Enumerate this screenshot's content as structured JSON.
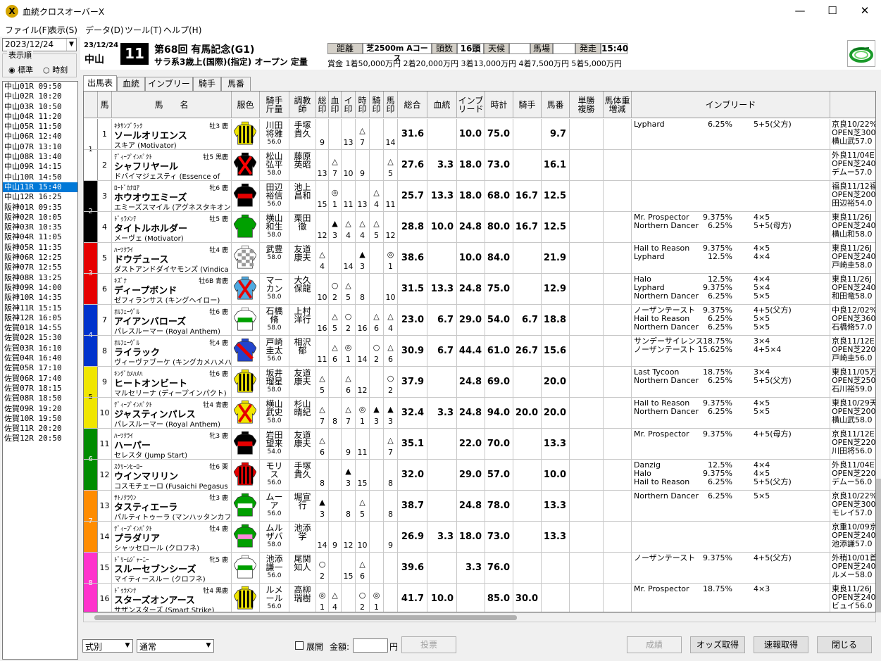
{
  "window": {
    "title": "血統クロスオーバーX",
    "icon_letter": "X",
    "minimize": "—",
    "maximize": "☐",
    "close": "✕"
  },
  "menu": [
    "ファイル(F)",
    "表示(S)",
    "データ(D)",
    "ツール(T)",
    "ヘルプ(H)"
  ],
  "left": {
    "date": "2023/12/24",
    "order_label": "表示順",
    "radio_standard": "標準",
    "radio_time": "時刻",
    "selected_index": 10,
    "races": [
      "中山01R 09:50",
      "中山02R 10:20",
      "中山03R 10:50",
      "中山04R 11:20",
      "中山05R 11:50",
      "中山06R 12:40",
      "中山07R 13:10",
      "中山08R 13:40",
      "中山09R 14:15",
      "中山10R 14:50",
      "中山11R 15:40",
      "中山12R 16:25",
      "阪神01R 09:35",
      "阪神02R 10:05",
      "阪神03R 10:35",
      "阪神04R 11:05",
      "阪神05R 11:35",
      "阪神06R 12:25",
      "阪神07R 12:55",
      "阪神08R 13:25",
      "阪神09R 14:00",
      "阪神10R 14:35",
      "阪神11R 15:15",
      "阪神12R 16:05",
      "佐賀01R 14:55",
      "佐賀02R 15:30",
      "佐賀03R 16:10",
      "佐賀04R 16:40",
      "佐賀05R 17:10",
      "佐賀06R 17:40",
      "佐賀07R 18:15",
      "佐賀08R 18:50",
      "佐賀09R 19:20",
      "佐賀10R 19:50",
      "佐賀11R 20:20",
      "佐賀12R 20:50"
    ]
  },
  "header": {
    "date": "23/12/24",
    "venue": "中山",
    "race_number": "11",
    "race_name": "第68回 有馬記念(G1)",
    "conditions": "サラ系3歳上(国際)(指定) オープン 定量",
    "distance_label": "距離",
    "distance": "芝2500m Aコース",
    "runners_label": "頭数",
    "runners": "16頭",
    "weather_label": "天候",
    "weather": "",
    "track_label": "馬場",
    "track": "",
    "start_label": "発走",
    "start": "15:40",
    "prize": "賞金 1着50,000万円  2着20,000万円  3着13,000万円  4着7,500万円  5着5,000万円"
  },
  "tabs": [
    "出馬表",
    "血統",
    "インブリード",
    "騎手",
    "馬番"
  ],
  "columns": {
    "umaban": "馬",
    "name": "馬　　名",
    "silk": "服色",
    "jockey": "騎手\n斤量",
    "trainer": "調教\n師",
    "m1": "総\n印",
    "m2": "血\n印",
    "m3": "イ\n印",
    "m4": "時\n印",
    "m5": "騎\n印",
    "m6": "馬\n印",
    "total": "総合",
    "blood": "血統",
    "inbreed": "インブ\nリード",
    "time": "時計",
    "jk": "騎手",
    "uma": "馬番",
    "odds": "単勝\n複勝",
    "weight": "馬体重\n増減",
    "inb_detail": "インブリード"
  },
  "waku_colors": [
    "#ffffff",
    "#000000",
    "#e60000",
    "#0033cc",
    "#f0e600",
    "#008c00",
    "#ff8c00",
    "#ff33cc"
  ],
  "horses": [
    {
      "waku": 1,
      "no": "1",
      "sire": "ｷﾀｻﾝﾌﾞﾗｯｸ",
      "meta": "牡3 鹿",
      "name": "ソールオリエンス",
      "dam": "スキア (Motivator)",
      "jockey": "川田\n将雅",
      "wt": "56.0",
      "trainer": "手塚\n貴久",
      "marks": [
        "9",
        "",
        "13",
        "△7",
        "",
        "14"
      ],
      "total": "31.6",
      "blood": "",
      "inbreed": "10.0",
      "time": "75.0",
      "jk": "",
      "uma": "9.7",
      "inb": [
        [
          "Lyphard",
          "6.25%",
          "5+5(父方)"
        ]
      ],
      "prev": [
        "京良10/22%",
        "OPEN芝300",
        "横山武57.0"
      ],
      "silk": [
        "#f0e600",
        "#000000",
        "stripe"
      ]
    },
    {
      "waku": 1,
      "no": "2",
      "sire": "ﾃﾞｨｰﾌﾟｲﾝﾊﾟｸﾄ",
      "meta": "牡5 黒鹿",
      "name": "シャフリヤール",
      "dam": "ドバイマジェスティ (Essence of",
      "jockey": "松山\n弘平",
      "wt": "58.0",
      "trainer": "藤原\n英昭",
      "marks": [
        "13",
        "△7",
        "10",
        "9",
        "",
        "△5"
      ],
      "total": "27.6",
      "blood": "3.3",
      "inbreed": "18.0",
      "time": "73.0",
      "jk": "",
      "uma": "16.1",
      "inb": [],
      "prev": [
        "外良11/04E",
        "OPEN芝240",
        "デムー57.0"
      ],
      "silk": [
        "#000000",
        "#ff0000",
        "cross"
      ]
    },
    {
      "waku": 2,
      "no": "3",
      "sire": "ﾛｰﾄﾞｶﾅﾛｱ",
      "meta": "牝6 鹿",
      "name": "ホウオウエミーズ",
      "dam": "エミーズスマイル (アグネスタキオン)",
      "jockey": "田辺\n裕信",
      "wt": "56.0",
      "trainer": "池上\n昌和",
      "marks": [
        "15",
        "◎1",
        "11",
        "13",
        "△4",
        "11"
      ],
      "total": "25.7",
      "blood": "13.3",
      "inbreed": "18.0",
      "time": "68.0",
      "jk": "16.7",
      "uma": "12.5",
      "inb": [],
      "prev": [
        "福良11/12福",
        "OPEN芝200",
        "田辺裕54.0"
      ],
      "silk": [
        "#000000",
        "#e60000",
        "band"
      ]
    },
    {
      "waku": 2,
      "no": "4",
      "sire": "ﾄﾞｩﾗﾒﾝﾃ",
      "meta": "牡5 鹿",
      "name": "タイトルホルダー",
      "dam": "メーヴェ (Motivator)",
      "jockey": "横山\n和生",
      "wt": "58.0",
      "trainer": "栗田\n徹",
      "marks": [
        "12",
        "▲3",
        "△4",
        "△4",
        "△5",
        "12"
      ],
      "total": "28.8",
      "blood": "10.0",
      "inbreed": "24.8",
      "time": "80.0",
      "jk": "16.7",
      "uma": "12.5",
      "inb": [
        [
          "Mr. Prospector",
          "9.375%",
          "4×5"
        ],
        [
          "Northern Dancer",
          "6.25%",
          "5+5(母方)"
        ]
      ],
      "prev": [
        "東良11/26J",
        "OPEN芝240",
        "横山和58.0"
      ],
      "silk": [
        "#00a000",
        "#f0e600",
        "plain"
      ]
    },
    {
      "waku": 3,
      "no": "5",
      "sire": "ﾊｰﾂｸﾗｲ",
      "meta": "牡4 鹿",
      "name": "ドウデュース",
      "dam": "ダストアンドダイヤモンズ (Vindica",
      "jockey": "武豊",
      "wt": "58.0",
      "trainer": "友道\n康夫",
      "marks": [
        "△4",
        "",
        "14",
        "▲3",
        "",
        "◎1"
      ],
      "total": "38.6",
      "blood": "",
      "inbreed": "10.0",
      "time": "84.0",
      "jk": "",
      "uma": "21.9",
      "inb": [
        [
          "Hail to Reason",
          "9.375%",
          "4×5"
        ],
        [
          "Lyphard",
          "12.5%",
          "4×4"
        ]
      ],
      "prev": [
        "東良11/26J",
        "OPEN芝240",
        "戸崎圭58.0"
      ],
      "silk": [
        "#ffffff",
        "#999999",
        "check"
      ]
    },
    {
      "waku": 3,
      "no": "6",
      "sire": "ｷｽﾞﾅ",
      "meta": "牡6B 青鹿",
      "name": "ディープボンド",
      "dam": "ゼフィランサス (キングヘイロー)",
      "jockey": "マー\nカン",
      "wt": "58.0",
      "trainer": "大久\n保龍",
      "marks": [
        "10",
        "○2",
        "△5",
        "8",
        "",
        "10"
      ],
      "total": "31.5",
      "blood": "13.3",
      "inbreed": "24.8",
      "time": "75.0",
      "jk": "",
      "uma": "12.9",
      "inb": [
        [
          "Halo",
          "12.5%",
          "4×4"
        ],
        [
          "Lyphard",
          "9.375%",
          "5×4"
        ],
        [
          "Northern Dancer",
          "6.25%",
          "5×5"
        ]
      ],
      "prev": [
        "東良11/26J",
        "OPEN芝240",
        "和田竜58.0"
      ],
      "silk": [
        "#4fa9e0",
        "#e60000",
        "cross"
      ]
    },
    {
      "waku": 4,
      "no": "7",
      "sire": "ｵﾙﾌｪｰｳﾞﾙ",
      "meta": "牡6 鹿",
      "name": "アイアンバローズ",
      "dam": "パレスルーマー (Royal Anthem)",
      "jockey": "石橋\n脩",
      "wt": "58.0",
      "trainer": "上村\n洋行",
      "marks": [
        "16",
        "△5",
        "○2",
        "16",
        "△6",
        "△4"
      ],
      "total": "23.0",
      "blood": "6.7",
      "inbreed": "29.0",
      "time": "54.0",
      "jk": "6.7",
      "uma": "18.8",
      "inb": [
        [
          "ノーザンテースト",
          "9.375%",
          "4+5(父方)"
        ],
        [
          "Hail to Reason",
          "6.25%",
          "5×5"
        ],
        [
          "Northern Dancer",
          "6.25%",
          "5×5"
        ]
      ],
      "prev": [
        "中良12/02%",
        "OPEN芝360",
        "石橋脩57.0"
      ],
      "silk": [
        "#ffffff",
        "#00a000",
        "band"
      ]
    },
    {
      "waku": 4,
      "no": "8",
      "sire": "ｵﾙﾌｪｰｳﾞﾙ",
      "meta": "牝4 鹿",
      "name": "ライラック",
      "dam": "ヴィーヴァブーケ (キングカメハメハ)",
      "jockey": "戸崎\n圭太",
      "wt": "56.0",
      "trainer": "相沢\n郁",
      "marks": [
        "11",
        "△6",
        "◎1",
        "14",
        "○2",
        "△6"
      ],
      "total": "30.9",
      "blood": "6.7",
      "inbreed": "44.4",
      "time": "61.0",
      "jk": "26.7",
      "uma": "15.6",
      "inb": [
        [
          "サンデーサイレンス",
          "18.75%",
          "3×4"
        ],
        [
          "ノーザンテースト",
          "15.625%",
          "4+5×4"
        ]
      ],
      "prev": [
        "京良11/12E",
        "OPEN芝220",
        "戸崎圭56.0"
      ],
      "silk": [
        "#2244cc",
        "#e60000",
        "sash"
      ]
    },
    {
      "waku": 5,
      "no": "9",
      "sire": "ｷﾝｸﾞｶﾒﾊﾒﾊ",
      "meta": "牡6 鹿",
      "name": "ヒートオンビート",
      "dam": "マルセリーナ (ディープインパクト)",
      "jockey": "坂井\n瑠星",
      "wt": "58.0",
      "trainer": "友道\n康夫",
      "marks": [
        "△5",
        "",
        "△6",
        "12",
        "",
        "○2"
      ],
      "total": "37.9",
      "blood": "",
      "inbreed": "24.8",
      "time": "69.0",
      "jk": "",
      "uma": "20.0",
      "inb": [
        [
          "Last Tycoon",
          "18.75%",
          "3×4"
        ],
        [
          "Northern Dancer",
          "6.25%",
          "5+5(父方)"
        ]
      ],
      "prev": [
        "東良11/05万",
        "OPEN芝250",
        "石川裕59.0"
      ],
      "silk": [
        "#f0e600",
        "#000000",
        "stripe"
      ]
    },
    {
      "waku": 5,
      "no": "10",
      "sire": "ﾃﾞｨｰﾌﾟｲﾝﾊﾟｸﾄ",
      "meta": "牡4 青鹿",
      "name": "ジャスティンパレス",
      "dam": "パレスルーマー (Royal Anthem)",
      "jockey": "横山\n武史",
      "wt": "58.0",
      "trainer": "杉山\n晴紀",
      "marks": [
        "△7",
        "8",
        "△7",
        "◎1",
        "▲3",
        "▲3"
      ],
      "total": "32.4",
      "blood": "3.3",
      "inbreed": "24.8",
      "time": "94.0",
      "jk": "20.0",
      "uma": "20.0",
      "inb": [
        [
          "Hail to Reason",
          "9.375%",
          "4×5"
        ],
        [
          "Northern Dancer",
          "6.25%",
          "5×5"
        ]
      ],
      "prev": [
        "東良10/29天",
        "OPEN芝200",
        "横山武58.0"
      ],
      "silk": [
        "#f0e600",
        "#e60000",
        "cross"
      ]
    },
    {
      "waku": 6,
      "no": "11",
      "sire": "ﾊｰﾂｸﾗｲ",
      "meta": "牝3 鹿",
      "name": "ハーパー",
      "dam": "セレスタ (Jump Start)",
      "jockey": "岩田\n望来",
      "wt": "54.0",
      "trainer": "友道\n康夫",
      "marks": [
        "△6",
        "",
        "9",
        "11",
        "",
        "△7"
      ],
      "total": "35.1",
      "blood": "",
      "inbreed": "22.0",
      "time": "70.0",
      "jk": "",
      "uma": "13.3",
      "inb": [
        [
          "Mr. Prospector",
          "9.375%",
          "4+5(母方)"
        ]
      ],
      "prev": [
        "京良11/12E",
        "OPEN芝220",
        "川田将56.0"
      ],
      "silk": [
        "#000000",
        "#e60000",
        "band"
      ]
    },
    {
      "waku": 6,
      "no": "12",
      "sire": "ｽｸﾘｰﾝﾋｰﾛｰ",
      "meta": "牡6 栗",
      "name": "ウインマリリン",
      "dam": "コスモチェーロ (Fusaichi Pegasus",
      "jockey": "モリ\nス",
      "wt": "56.0",
      "trainer": "手塚\n貴久",
      "marks": [
        "8",
        "",
        "▲3",
        "15",
        "",
        "8"
      ],
      "total": "32.0",
      "blood": "",
      "inbreed": "29.0",
      "time": "57.0",
      "jk": "",
      "uma": "10.0",
      "inb": [
        [
          "Danzig",
          "12.5%",
          "4×4"
        ],
        [
          "Halo",
          "9.375%",
          "4×5"
        ],
        [
          "Hail to Reason",
          "6.25%",
          "5+5(父方)"
        ]
      ],
      "prev": [
        "外良11/04E",
        "OPEN芝220",
        "デムー56.0"
      ],
      "silk": [
        "#e60000",
        "#000000",
        "stripe"
      ]
    },
    {
      "waku": 7,
      "no": "13",
      "sire": "ｻﾄﾉｸﾗｳﾝ",
      "meta": "牡3 鹿",
      "name": "タスティエーラ",
      "dam": "パルティトゥーラ (マンハッタンカフェ)",
      "jockey": "ムー\nア",
      "wt": "56.0",
      "trainer": "堀宣\n行",
      "marks": [
        "▲3",
        "",
        "8",
        "△5",
        "",
        "8"
      ],
      "total": "38.7",
      "blood": "",
      "inbreed": "24.8",
      "time": "78.0",
      "jk": "",
      "uma": "13.3",
      "inb": [
        [
          "Northern Dancer",
          "6.25%",
          "5×5"
        ]
      ],
      "prev": [
        "京良10/22%",
        "OPEN芝300",
        "モレイ57.0"
      ],
      "silk": [
        "#00a000",
        "#ffffff",
        "band"
      ]
    },
    {
      "waku": 7,
      "no": "14",
      "sire": "ﾃﾞｨｰﾌﾟｲﾝﾊﾟｸﾄ",
      "meta": "牡4 鹿",
      "name": "プラダリア",
      "dam": "シャッセロール (クロフネ)",
      "jockey": "ムル\nザバ",
      "wt": "58.0",
      "trainer": "池添\n学",
      "marks": [
        "14",
        "9",
        "12",
        "10",
        "",
        "9"
      ],
      "total": "26.9",
      "blood": "3.3",
      "inbreed": "18.0",
      "time": "73.0",
      "jk": "",
      "uma": "13.3",
      "inb": [],
      "prev": [
        "京重10/09京",
        "OPEN芝240",
        "池添謙57.0"
      ],
      "silk": [
        "#00a000",
        "#ff88dd",
        "band"
      ]
    },
    {
      "waku": 8,
      "no": "15",
      "sire": "ﾄﾞﾘｰﾑｼﾞｬｰﾆｰ",
      "meta": "牝5 鹿",
      "name": "スルーセブンシーズ",
      "dam": "マイティースルー (クロフネ)",
      "jockey": "池添\n謙一",
      "wt": "56.0",
      "trainer": "尾関\n知人",
      "marks": [
        "○2",
        "",
        "15",
        "△6",
        "",
        ""
      ],
      "total": "39.6",
      "blood": "",
      "inbreed": "3.3",
      "time": "76.0",
      "jk": "",
      "uma": "",
      "inb": [
        [
          "ノーザンテースト",
          "9.375%",
          "4+5(父方)"
        ]
      ],
      "prev": [
        "外稍10/01首",
        "OPEN芝240",
        "ルメー58.0"
      ],
      "silk": [
        "#ffffff",
        "#00a000",
        "band"
      ]
    },
    {
      "waku": 8,
      "no": "16",
      "sire": "ﾄﾞｩﾗﾒﾝﾃ",
      "meta": "牡4 黒鹿",
      "name": "スターズオンアース",
      "dam": "サザンスターズ (Smart Strike)",
      "jockey": "ルメ\nール",
      "wt": "56.0",
      "trainer": "高柳\n瑞樹",
      "marks": [
        "◎1",
        "△4",
        "",
        "○2",
        "◎1",
        ""
      ],
      "total": "41.7",
      "blood": "10.0",
      "inbreed": "",
      "time": "85.0",
      "jk": "30.0",
      "uma": "",
      "inb": [
        [
          "Mr. Prospector",
          "18.75%",
          "4×3"
        ]
      ],
      "prev": [
        "東良11/26J",
        "OPEN芝240",
        "ビュイ56.0"
      ],
      "silk": [
        "#f0e600",
        "#000000",
        "stripe"
      ]
    }
  ],
  "bottom": {
    "bet_type": "式別",
    "mode": "通常",
    "expand": "展開",
    "amount_label": "金額:",
    "yen": "円",
    "vote": "投票",
    "result": "成績",
    "odds": "オッズ取得",
    "quick": "速報取得",
    "close": "閉じる"
  }
}
